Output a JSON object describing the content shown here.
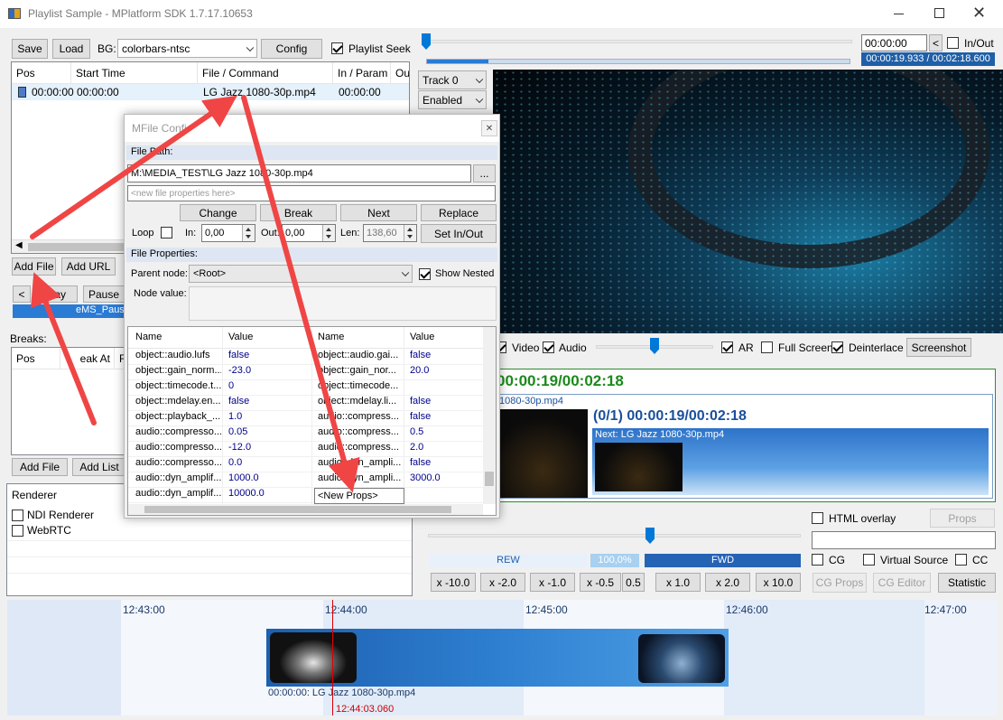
{
  "window": {
    "title": "Playlist Sample - MPlatform SDK 1.7.17.10653"
  },
  "toolbar": {
    "save": "Save",
    "load": "Load",
    "bg_label": "BG:",
    "bg_value": "colorbars-ntsc",
    "config": "Config",
    "playlist_seek": "Playlist Seek"
  },
  "playlist": {
    "columns": [
      "Pos",
      "Start Time",
      "File / Command",
      "In / Param",
      "Ou"
    ],
    "rows": [
      {
        "pos": "00:00:00",
        "start": "00:00:00",
        "file": "LG Jazz 1080-30p.mp4",
        "in": "00:00:00"
      }
    ]
  },
  "playlist_buttons": {
    "add_file": "Add File",
    "add_url": "Add URL",
    "prev": "<",
    "play": "lay",
    "pause": "Pause",
    "status": "eMS_Paus"
  },
  "breaks": {
    "title": "Breaks:",
    "columns": [
      "Pos",
      "eak At",
      "Fi"
    ],
    "add_file": "Add File",
    "add_list": "Add List"
  },
  "renderer": {
    "column": "Renderer",
    "column2": "C",
    "items": [
      {
        "label": "NDI Renderer"
      },
      {
        "label": "WebRTC"
      }
    ]
  },
  "seek": {
    "time_input": "00:00:00",
    "back": "<",
    "inout": "In/Out",
    "position": "00:00:19.933 / 00:02:18.600"
  },
  "track": {
    "track": "Track 0",
    "enabled": "Enabled"
  },
  "video_opts": {
    "video": "Video",
    "audio": "Audio",
    "ar": "AR",
    "full_screen": "Full Screen",
    "deinterlace": "Deinterlace",
    "screenshot": "Screenshot"
  },
  "preview": {
    "time_main": "00:00:19/00:02:18",
    "file_label": "1080-30p.mp4",
    "time_sub": "(0/1) 00:00:19/00:02:18",
    "next": "Next: LG Jazz 1080-30p.mp4"
  },
  "right_controls": {
    "html_overlay": "HTML overlay",
    "props": "Props",
    "cg": "CG",
    "virtual_source": "Virtual Source",
    "cc": "CC",
    "cg_props": "CG Props",
    "cg_editor": "CG Editor",
    "statistic": "Statistic"
  },
  "speed": {
    "rew": "REW",
    "value": "100,0%",
    "fwd": "FWD",
    "buttons": [
      "x -10.0",
      "x -2.0",
      "x -1.0",
      "x -0.5",
      "0.5",
      "x 1.0",
      "x 2.0",
      "x 10.0"
    ]
  },
  "timeline": {
    "ticks": [
      "12:43:00",
      "12:44:00",
      "12:45:00",
      "12:46:00",
      "12:47:00"
    ],
    "clip_label": "00:00:00: LG Jazz 1080-30p.mp4",
    "cursor_time": "12:44:03.060"
  },
  "dialog": {
    "title": "MFile Confi",
    "file_path_label": "File Path:",
    "file_path": "M:\\MEDIA_TEST\\LG Jazz 1080-30p.mp4",
    "browse": "...",
    "props_placeholder": "<new file properties here>",
    "change": "Change",
    "break": "Break",
    "next": "Next",
    "replace": "Replace",
    "loop": "Loop",
    "in_label": "In:",
    "in_value": "0,00",
    "out_label": "Out:",
    "out_value": "0,00",
    "len_label": "Len:",
    "len_value": "138,60",
    "set_inout": "Set In/Out",
    "file_props_label": "File Properties:",
    "parent_node_label": "Parent node:",
    "parent_node": "<Root>",
    "show_nested": "Show Nested",
    "node_value_label": "Node value:",
    "grid_headers": [
      "Name",
      "Value",
      "Name",
      "Value"
    ],
    "grid_rows": [
      {
        "k": "object::audio.lufs",
        "v": "false",
        "k2": "object::audio.gai...",
        "v2": "false"
      },
      {
        "k": "object::gain_norm...",
        "v": "-23.0",
        "k2": "object::gain_nor...",
        "v2": "20.0"
      },
      {
        "k": "object::timecode.t...",
        "v": "0",
        "k2": "object::timecode...",
        "v2": ""
      },
      {
        "k": "object::mdelay.en...",
        "v": "false",
        "k2": "object::mdelay.li...",
        "v2": "false"
      },
      {
        "k": "object::playback_...",
        "v": "1.0",
        "k2": "audio::compress...",
        "v2": "false"
      },
      {
        "k": "audio::compresso...",
        "v": "0.05",
        "k2": "audio::compress...",
        "v2": "0.5"
      },
      {
        "k": "audio::compresso...",
        "v": "-12.0",
        "k2": "audio::compress...",
        "v2": "2.0"
      },
      {
        "k": "audio::compresso...",
        "v": "0.0",
        "k2": "audio::dyn_ampli...",
        "v2": "false"
      },
      {
        "k": "audio::dyn_amplif...",
        "v": "1000.0",
        "k2": "audio::dyn_ampli...",
        "v2": "3000.0"
      },
      {
        "k": "audio::dyn_amplif...",
        "v": "10000.0",
        "k2": "",
        "v2": ""
      }
    ],
    "new_props": "<New Props>"
  }
}
